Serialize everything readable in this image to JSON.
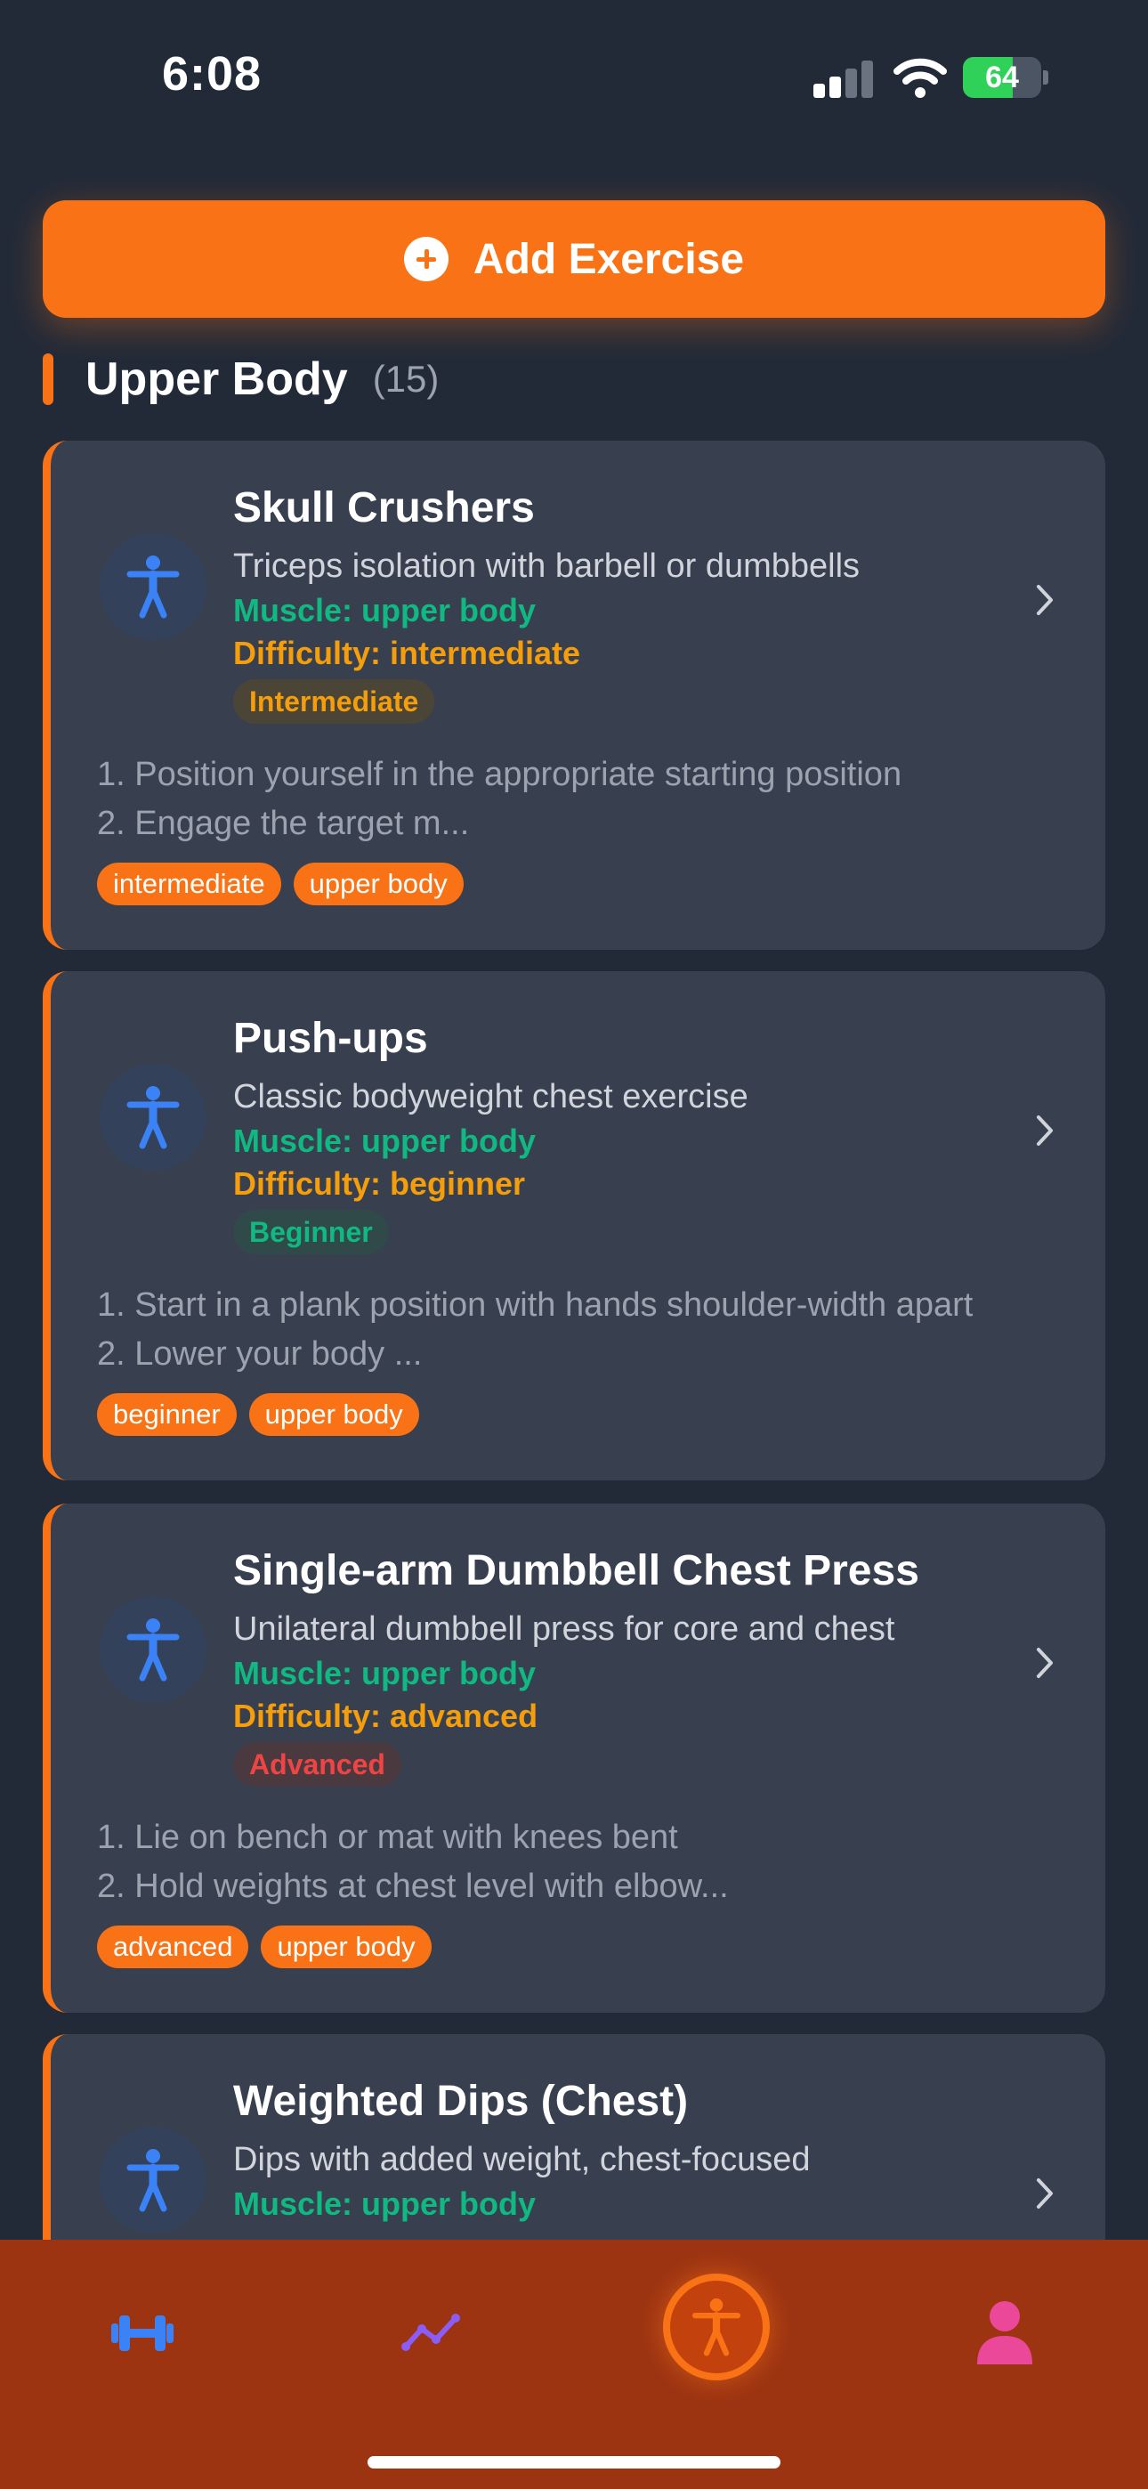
{
  "status_bar": {
    "time": "6:08",
    "battery_level": "64",
    "battery_charging": true
  },
  "add_button": {
    "label": "Add Exercise"
  },
  "section": {
    "title": "Upper Body",
    "count": "(15)"
  },
  "exercises": [
    {
      "name": "Skull Crushers",
      "description": "Triceps isolation with barbell or dumbbells",
      "muscle": "Muscle: upper body",
      "difficulty": "Difficulty: intermediate",
      "level": "Intermediate",
      "instruction_1": "1. Position yourself in the appropriate starting position",
      "instruction_2": "2. Engage the target m...",
      "tags": [
        "intermediate",
        "upper body"
      ]
    },
    {
      "name": "Push-ups",
      "description": "Classic bodyweight chest exercise",
      "muscle": "Muscle: upper body",
      "difficulty": "Difficulty: beginner",
      "level": "Beginner",
      "instruction_1": "1. Start in a plank position with hands shoulder-width apart",
      "instruction_2": "2. Lower your body ...",
      "tags": [
        "beginner",
        "upper body"
      ]
    },
    {
      "name": "Single-arm Dumbbell Chest Press",
      "description": "Unilateral dumbbell press for core and chest",
      "muscle": "Muscle: upper body",
      "difficulty": "Difficulty: advanced",
      "level": "Advanced",
      "instruction_1": "1. Lie on bench or mat with knees bent",
      "instruction_2": "2. Hold weights at chest level with elbow...",
      "tags": [
        "advanced",
        "upper body"
      ]
    },
    {
      "name": "Weighted Dips (Chest)",
      "description": "Dips with added weight, chest-focused",
      "muscle": "Muscle: upper body"
    }
  ],
  "colors": {
    "accent": "#f97316",
    "background": "#222a38",
    "card": "#383f4f",
    "muscle_text": "#10b981",
    "difficulty_text": "#f59e0b",
    "tab_bar": "#9c3412"
  },
  "tab_bar": {
    "tabs": [
      {
        "icon": "dumbbell-icon",
        "active": false
      },
      {
        "icon": "trend-line-icon",
        "active": false
      },
      {
        "icon": "accessibility-person-icon",
        "active": true
      },
      {
        "icon": "person-icon",
        "active": false
      }
    ]
  }
}
